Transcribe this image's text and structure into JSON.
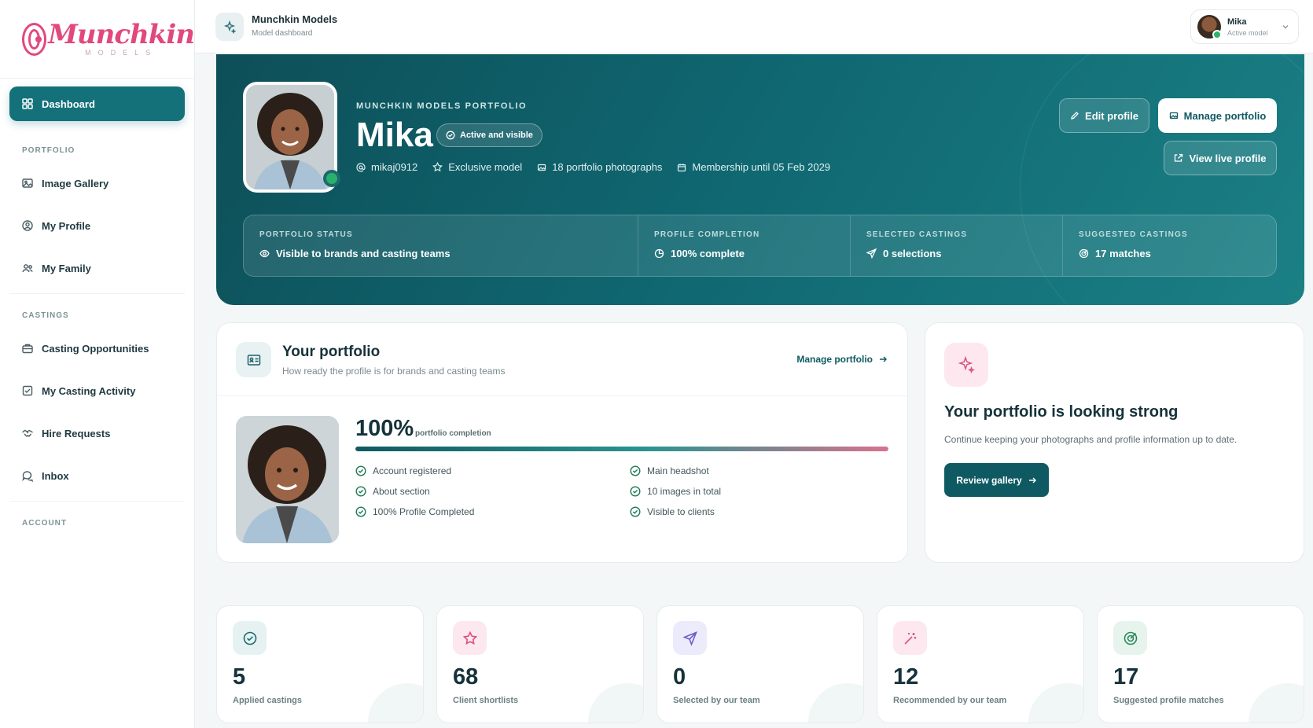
{
  "brand": {
    "name": "Munchkin",
    "sub": "MODELS"
  },
  "sidebar": {
    "items": [
      {
        "label": "Dashboard",
        "icon": "grid-icon",
        "active": true
      },
      {
        "section": "PORTFOLIO"
      },
      {
        "label": "Image Gallery",
        "icon": "image-icon"
      },
      {
        "label": "My Profile",
        "icon": "user-circle-icon"
      },
      {
        "label": "My Family",
        "icon": "users-icon"
      },
      {
        "section": "CASTINGS"
      },
      {
        "label": "Casting Opportunities",
        "icon": "briefcase-icon"
      },
      {
        "label": "My Casting Activity",
        "icon": "check-square-icon"
      },
      {
        "label": "Hire Requests",
        "icon": "handshake-icon"
      },
      {
        "label": "Inbox",
        "icon": "chat-icon"
      },
      {
        "section": "ACCOUNT"
      }
    ],
    "sections": {
      "portfolio": "PORTFOLIO",
      "castings": "CASTINGS",
      "account": "ACCOUNT"
    },
    "labels": {
      "dashboard": "Dashboard",
      "gallery": "Image Gallery",
      "profile": "My Profile",
      "family": "My Family",
      "opportunities": "Casting Opportunities",
      "activity": "My Casting Activity",
      "hire": "Hire Requests",
      "inbox": "Inbox"
    }
  },
  "topbar": {
    "title": "Munchkin Models",
    "subtitle": "Model dashboard",
    "user": {
      "name": "Mika",
      "role": "Active model"
    }
  },
  "hero": {
    "eyebrow": "MUNCHKIN MODELS PORTFOLIO",
    "name": "Mika",
    "badge": "Active and visible",
    "meta": {
      "username": "mikaj0912",
      "tier": "Exclusive model",
      "photos": "18 portfolio photographs",
      "membership": "Membership until 05 Feb 2029"
    },
    "buttons": {
      "edit": "Edit profile",
      "manage": "Manage portfolio",
      "live": "View live profile"
    },
    "stats": [
      {
        "label": "PORTFOLIO STATUS",
        "value": "Visible to brands and casting teams",
        "icon": "eye-icon"
      },
      {
        "label": "PROFILE COMPLETION",
        "value": "100% complete",
        "icon": "pie-icon"
      },
      {
        "label": "SELECTED CASTINGS",
        "value": "0 selections",
        "icon": "send-icon"
      },
      {
        "label": "SUGGESTED CASTINGS",
        "value": "17 matches",
        "icon": "target-icon"
      }
    ]
  },
  "portfolio": {
    "title": "Your portfolio",
    "subtitle": "How ready the profile is for brands and casting teams",
    "link": "Manage portfolio",
    "percent": "100%",
    "percent_label": "portfolio completion",
    "completion": 1.0,
    "checks": [
      "Account registered",
      "Main headshot",
      "About section",
      "10 images in total",
      "100% Profile Completed",
      "Visible to clients"
    ]
  },
  "strong": {
    "title": "Your portfolio is looking strong",
    "desc": "Continue keeping your photographs and profile information up to date.",
    "button": "Review gallery"
  },
  "metrics": [
    {
      "value": "5",
      "label": "Applied castings",
      "icon": "check-circle-icon",
      "bg": "#e6f2f2",
      "color": "#1c6b70"
    },
    {
      "value": "68",
      "label": "Client shortlists",
      "icon": "star-icon",
      "bg": "#fde8ef",
      "color": "#d9517f"
    },
    {
      "value": "0",
      "label": "Selected by our team",
      "icon": "send-icon",
      "bg": "#ecebfb",
      "color": "#6a5fc9"
    },
    {
      "value": "12",
      "label": "Recommended by our team",
      "icon": "magic-wand-icon",
      "bg": "#fde8ef",
      "color": "#d9517f"
    },
    {
      "value": "17",
      "label": "Suggested profile matches",
      "icon": "target-icon",
      "bg": "#e7f4ee",
      "color": "#2b8a5c"
    }
  ],
  "colors": {
    "accent": "#14717a",
    "brand_pink": "#e2487e",
    "hero_dark": "#0e4f58",
    "success": "#2cb36c"
  }
}
